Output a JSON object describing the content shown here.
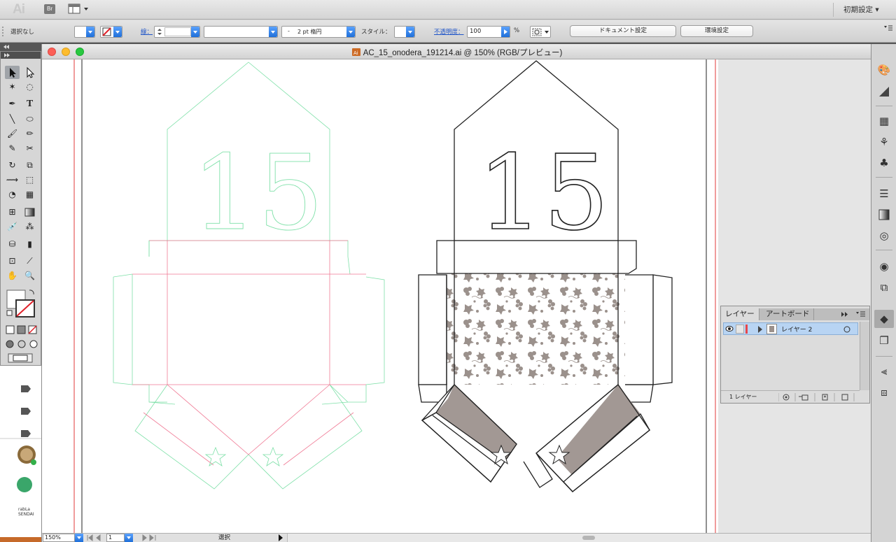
{
  "app": {
    "logo": "Ai",
    "bridge_label": "Br",
    "workspace_label": "初期設定 ▾"
  },
  "control_bar": {
    "selection_status": "選択なし",
    "stroke_label": "線：",
    "stroke_width_value": "",
    "stroke_profile": "",
    "brush_value": "2 pt 楕円",
    "brush_prefix": "-",
    "style_label": "スタイル：",
    "opacity_label": "不透明度：",
    "opacity_value": "100",
    "opacity_unit": "%",
    "document_settings_button": "ドキュメント設定",
    "preferences_button": "環境設定"
  },
  "document": {
    "title": "AC_15_onodera_191214.ai @ 150% (RGB/プレビュー)",
    "artwork_number": "15"
  },
  "status_bar": {
    "zoom": "150%",
    "artboard_number": "1",
    "status_text": "選択"
  },
  "layers_panel": {
    "tabs": [
      "レイヤー",
      "アートボード"
    ],
    "layer_name": "レイヤー 2",
    "layer_count": "1 レイヤー"
  },
  "colors": {
    "accent_blue": "#1f6fd8",
    "guide_green": "#7ee0a8",
    "guide_red": "#f07a95",
    "pattern_gray": "#9b918c",
    "band_brown": "#a29894"
  }
}
